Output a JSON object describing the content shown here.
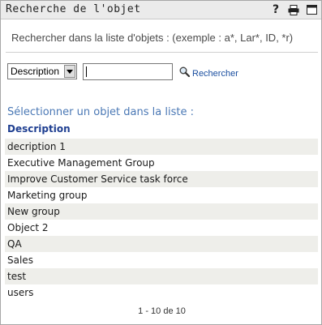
{
  "dialog": {
    "title": "Recherche de l'objet",
    "toolbar_icons": [
      "help-icon",
      "print-icon",
      "maximize-icon"
    ]
  },
  "instructions": "Rechercher dans la liste d'objets : (exemple : a*, Lar*, ID, *r)",
  "search": {
    "attribute_selected": "Description",
    "query_value": "",
    "button_label": "Rechercher",
    "button_icon": "magnifier-icon"
  },
  "results": {
    "prompt": "Sélectionner un objet dans la liste :",
    "column_header": "Description",
    "items": [
      "decription 1",
      "Executive Management Group",
      "Improve Customer Service task force",
      "Marketing group",
      "New group",
      "Object 2",
      "QA",
      "Sales",
      "test",
      "users"
    ],
    "pagination": "1 - 10 de 10"
  },
  "colors": {
    "title_bar": "#ebebeb",
    "link": "#1b4fa0",
    "prompt": "#4a78b5",
    "header": "#1f3f91",
    "row_stripe": "#eeeeea"
  }
}
